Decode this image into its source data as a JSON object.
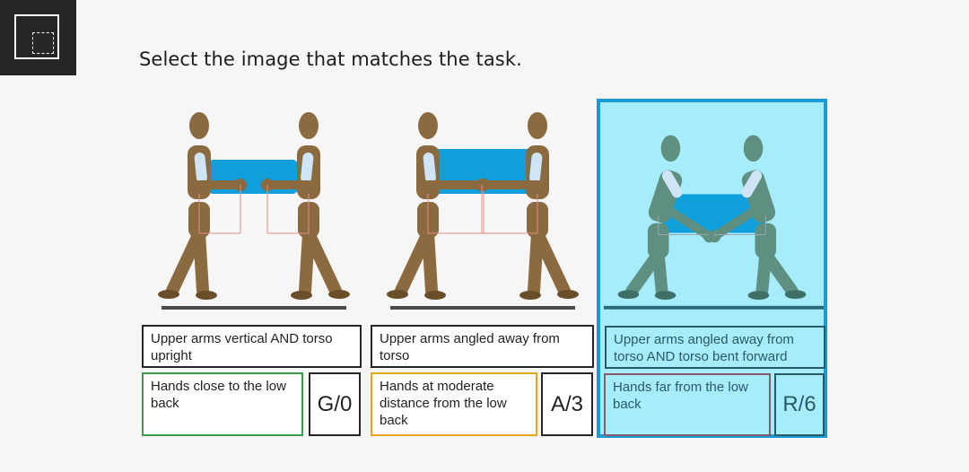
{
  "toolbar": {
    "select_region_icon": "dashed-selection-square"
  },
  "prompt": "Select the image that matches the task.",
  "options": [
    {
      "posture": "Upper arms vertical AND torso upright",
      "hands": "Hands close to the low back",
      "score": "G/0",
      "hands_border_color": "#3a9c4a",
      "figure_style": "upright-close",
      "selected": false
    },
    {
      "posture": "Upper arms angled away from torso",
      "hands": "Hands at moderate distance from the low back",
      "score": "A/3",
      "hands_border_color": "#e9a21f",
      "figure_style": "upright-moderate",
      "selected": false
    },
    {
      "posture": "Upper arms angled away from torso AND torso bent forward",
      "hands": "Hands far from the low back",
      "score": "R/6",
      "hands_border_color": "#8a5a6a",
      "figure_style": "bent-far",
      "selected": true
    }
  ],
  "colors": {
    "figure_brown": "#8a6a3e",
    "figure_teal": "#5e8f80",
    "box_blue": "#0fa0dc",
    "selection_border": "#169bd4",
    "selection_fill": "#a6ecfb"
  }
}
